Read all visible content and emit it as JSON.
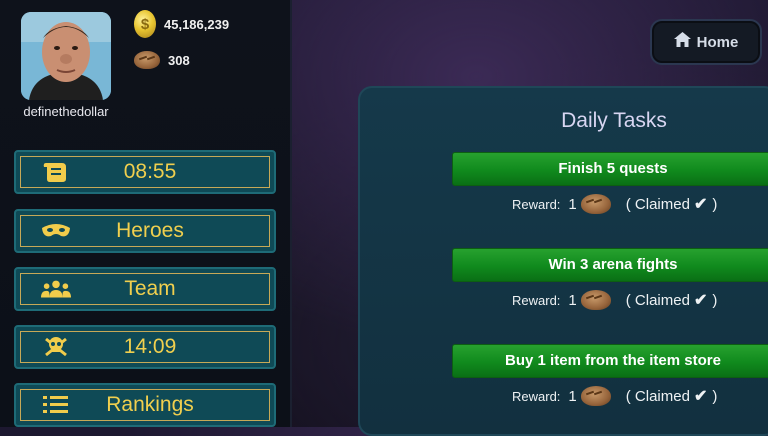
{
  "player": {
    "username": "definethedollar",
    "coins": "45,186,239",
    "bread": "308"
  },
  "menu": [
    {
      "icon": "scroll-icon",
      "label": "08:55"
    },
    {
      "icon": "mask-icon",
      "label": "Heroes"
    },
    {
      "icon": "team-icon",
      "label": "Team"
    },
    {
      "icon": "skull-crossbones-icon",
      "label": "14:09"
    },
    {
      "icon": "list-icon",
      "label": "Rankings"
    }
  ],
  "home_button": {
    "label": "Home",
    "icon": "home-icon"
  },
  "daily_tasks": {
    "title": "Daily Tasks",
    "reward_label": "Reward:",
    "items": [
      {
        "title": "Finish 5 quests",
        "reward_count": "1",
        "status": "( Claimed",
        "status_end": ")"
      },
      {
        "title": "Win 3 arena fights",
        "reward_count": "1",
        "status": "( Claimed",
        "status_end": ")"
      },
      {
        "title": "Buy 1 item from the item store",
        "reward_count": "1",
        "status": "( Claimed",
        "status_end": ")"
      }
    ]
  },
  "colors": {
    "accent_gold": "#f0cf4e",
    "menu_teal": "#0f4a56",
    "task_green": "#108a1d",
    "panel_bg": "#15394a"
  }
}
